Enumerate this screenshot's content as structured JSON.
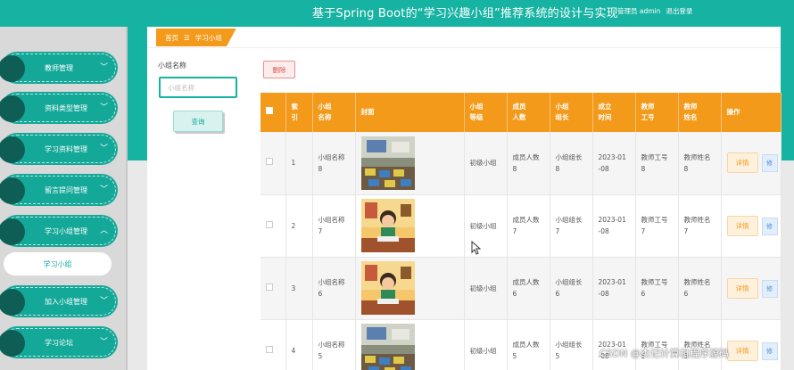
{
  "header": {
    "title": "基于Spring Boot的“学习兴趣小组”推荐系统的设计与实现",
    "role_text": "管理员 admin",
    "logout_label": "退出登录"
  },
  "sidebar": {
    "items": [
      {
        "label": "教师管理",
        "icon": "chevron-down-icon"
      },
      {
        "label": "资料类型管理",
        "icon": "chevron-down-icon"
      },
      {
        "label": "学习资料管理",
        "icon": "chevron-down-icon"
      },
      {
        "label": "留言提问管理",
        "icon": "chevron-down-icon"
      },
      {
        "label": "学习小组管理",
        "icon": "chevron-up-icon"
      },
      {
        "label": "加入小组管理",
        "icon": "chevron-down-icon"
      },
      {
        "label": "学习论坛",
        "icon": "chevron-down-icon"
      }
    ],
    "sub_item": "学习小组"
  },
  "breadcrumb": {
    "home": "首页",
    "separator": "☰",
    "current": "学习小组"
  },
  "search": {
    "label": "小组名称",
    "placeholder": "小组名称",
    "button": "查询"
  },
  "toolbar": {
    "delete_label": "删除"
  },
  "table": {
    "headers": [
      "索\n引",
      "小组\n名称",
      "封面",
      "小组\n等级",
      "成员\n人数",
      "小组\n组长",
      "成立\n时间",
      "教师\n工号",
      "教师\n姓名",
      "操作"
    ],
    "rows": [
      {
        "index": "1",
        "name": "小组名称\n8",
        "cover": "classroom-photo",
        "level": "初级小组",
        "members": "成员人数\n8",
        "leader": "小组组长\n8",
        "date": "2023-01\n-08",
        "teacher_id": "教师工号\n8",
        "teacher_name": "教师姓名\n8",
        "detail": "详情",
        "edit": "修"
      },
      {
        "index": "2",
        "name": "小组名称\n7",
        "cover": "cartoon-student",
        "level": "初级小组",
        "members": "成员人数\n7",
        "leader": "小组组长\n7",
        "date": "2023-01\n-08",
        "teacher_id": "教师工号\n7",
        "teacher_name": "教师姓名\n7",
        "detail": "详情",
        "edit": "修"
      },
      {
        "index": "3",
        "name": "小组名称\n6",
        "cover": "cartoon-student",
        "level": "初级小组",
        "members": "成员人数\n6",
        "leader": "小组组长\n6",
        "date": "2023-01\n-08",
        "teacher_id": "教师工号\n6",
        "teacher_name": "教师姓名\n6",
        "detail": "详情",
        "edit": "修"
      },
      {
        "index": "4",
        "name": "小组名称\n5",
        "cover": "classroom-photo",
        "level": "初级小组",
        "members": "成员人数\n5",
        "leader": "小组组长\n5",
        "date": "2023-01\n-08",
        "teacher_id": "教师工号\n5",
        "teacher_name": "教师姓名\n5",
        "detail": "详情",
        "edit": "修"
      }
    ]
  },
  "watermark": "CSDN @杰记计算机程序源码",
  "colors": {
    "primary": "#16b3a3",
    "accent": "#f39a1a",
    "danger": "#d9534f"
  }
}
